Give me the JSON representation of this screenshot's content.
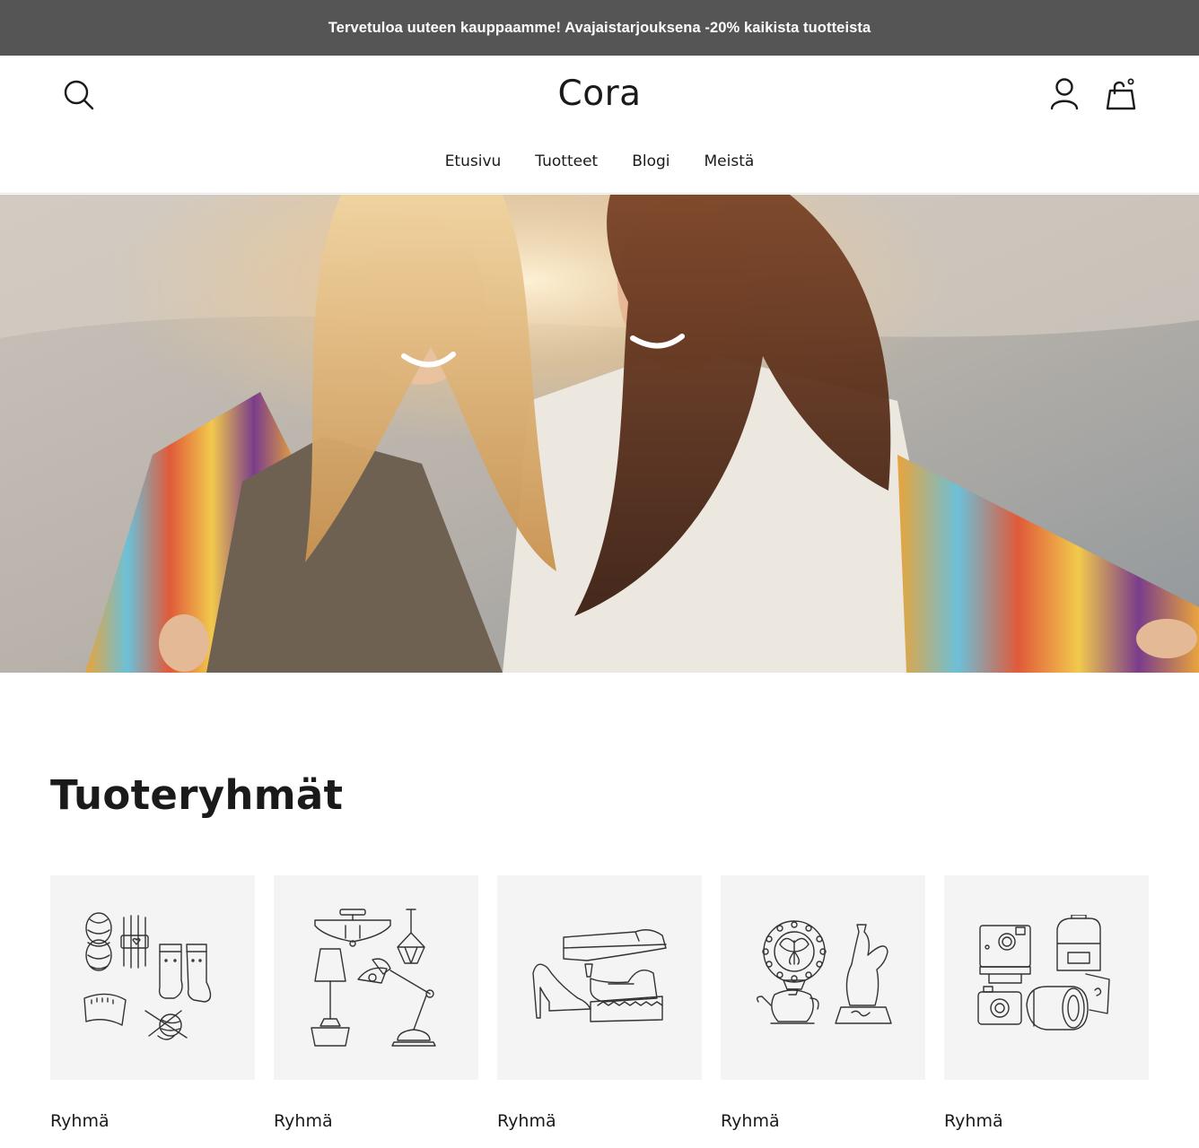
{
  "announcement": {
    "text": "Tervetuloa uuteen kauppaamme! Avajaistarjouksena -20% kaikista tuotteista"
  },
  "header": {
    "logo": "Cora",
    "icons": {
      "search": "search-icon",
      "account": "user-icon",
      "cart": "shopping-bag-icon"
    }
  },
  "nav": {
    "items": [
      {
        "label": "Etusivu"
      },
      {
        "label": "Tuotteet"
      },
      {
        "label": "Blogi"
      },
      {
        "label": "Meistä"
      }
    ]
  },
  "hero": {
    "image": "hero-image"
  },
  "categories": {
    "title": "Tuoteryhmät",
    "items": [
      {
        "label": "Ryhmä",
        "icon": "yarn-socks-icon"
      },
      {
        "label": "Ryhmä",
        "icon": "lamps-icon"
      },
      {
        "label": "Ryhmä",
        "icon": "shoes-icon"
      },
      {
        "label": "Ryhmä",
        "icon": "decor-icon"
      },
      {
        "label": "Ryhmä",
        "icon": "camera-bags-icon"
      }
    ]
  },
  "colors": {
    "announcement_bg": "#555555",
    "tile_bg": "#f4f4f4",
    "text": "#1a1a1a"
  }
}
